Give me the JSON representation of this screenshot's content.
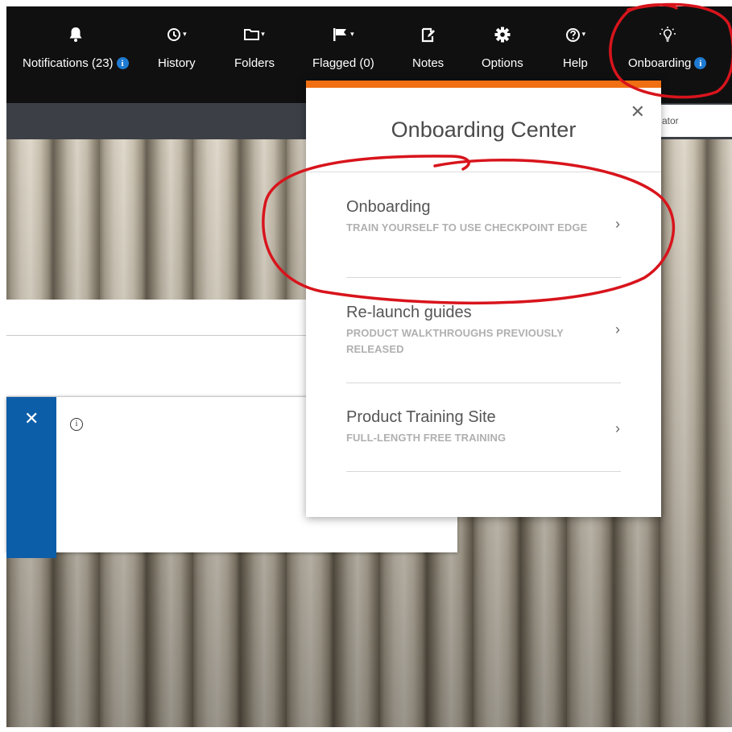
{
  "nav": {
    "items": [
      {
        "id": "notifications",
        "label": "Notifications (23)",
        "icon": "bell-icon",
        "has_info": true
      },
      {
        "id": "history",
        "label": "History",
        "icon": "clock-icon",
        "has_caret": true
      },
      {
        "id": "folders",
        "label": "Folders",
        "icon": "folder-icon",
        "has_caret": true
      },
      {
        "id": "flagged",
        "label": "Flagged (0)",
        "icon": "flag-icon",
        "has_caret": true
      },
      {
        "id": "notes",
        "label": "Notes",
        "icon": "note-icon"
      },
      {
        "id": "options",
        "label": "Options",
        "icon": "gear-icon"
      },
      {
        "id": "help",
        "label": "Help",
        "icon": "question-icon",
        "has_caret": true
      },
      {
        "id": "onboarding",
        "label": "Onboarding",
        "icon": "lightbulb-icon",
        "has_info": true
      }
    ],
    "info_glyph": "i",
    "caret_glyph": "▾"
  },
  "search": {
    "partial_text": "ator"
  },
  "popup": {
    "title": "Onboarding Center",
    "close_glyph": "✕",
    "items": [
      {
        "title": "Onboarding",
        "subtitle": "TRAIN YOURSELF TO USE CHECKPOINT EDGE"
      },
      {
        "title": "Re-launch guides",
        "subtitle": "PRODUCT WALKTHROUGHS PREVIOUSLY RELEASED"
      },
      {
        "title": "Product Training Site",
        "subtitle": "FULL-LENGTH FREE TRAINING"
      }
    ],
    "chevron_glyph": "›"
  },
  "notice": {
    "close_glyph": "✕",
    "info_glyph": "i"
  },
  "colors": {
    "nav_bg": "#101010",
    "accent_orange": "#ef6f12",
    "info_blue": "#1f7ad1",
    "notice_blue": "#0d5ea8",
    "annotation_red": "#d8141c"
  }
}
